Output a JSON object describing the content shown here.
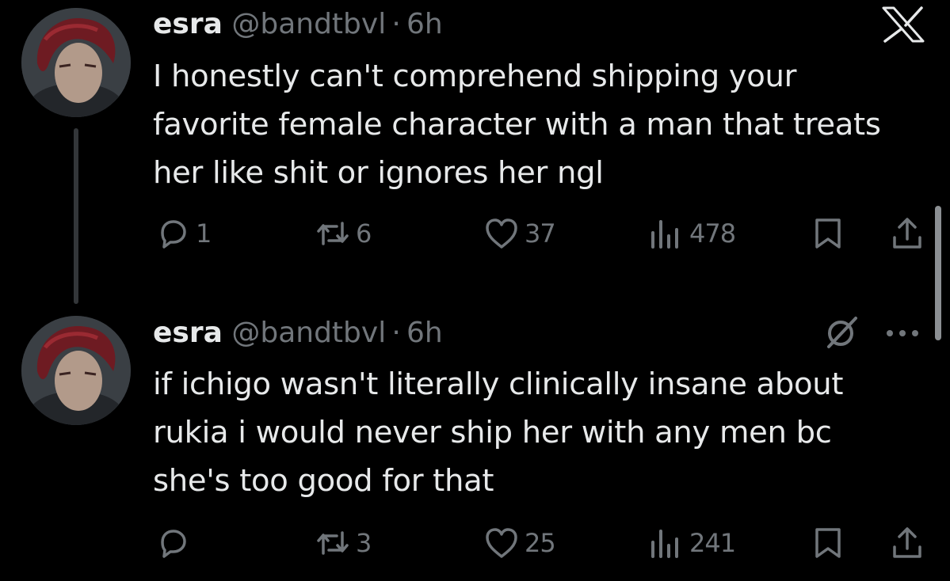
{
  "tweets": [
    {
      "author": {
        "name": "esra",
        "handle": "@bandtbvl",
        "separator": "·",
        "time": "6h"
      },
      "text": "I honestly can't comprehend shipping your favorite female character with a man that treats her like shit or ignores her ngl",
      "stats": {
        "replies": "1",
        "reposts": "6",
        "likes": "37",
        "views": "478"
      }
    },
    {
      "author": {
        "name": "esra",
        "handle": "@bandtbvl",
        "separator": "·",
        "time": "6h"
      },
      "text": "if ichigo wasn't literally clinically insane about rukia i would never ship her with any men bc she's too good for that",
      "stats": {
        "replies": "",
        "reposts": "3",
        "likes": "25",
        "views": "241"
      }
    }
  ],
  "icons": {
    "brand": "x-logo-icon",
    "reply": "reply-icon",
    "repost": "repost-icon",
    "like": "heart-icon",
    "views": "views-icon",
    "bookmark": "bookmark-icon",
    "share": "share-icon",
    "grok": "grok-icon",
    "more": "more-icon"
  },
  "colors": {
    "background": "#000000",
    "text": "#e7e9ea",
    "secondary": "#71767b",
    "thread_line": "#333639"
  }
}
